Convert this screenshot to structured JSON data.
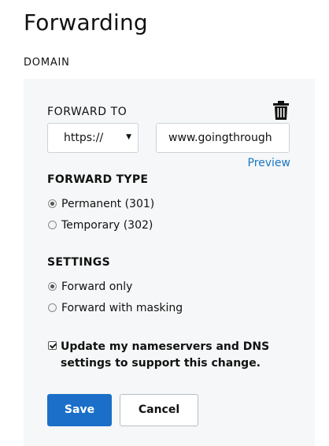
{
  "page": {
    "title": "Forwarding",
    "section_label": "DOMAIN"
  },
  "forward_to": {
    "label": "FORWARD TO",
    "delete_icon": "trash-icon",
    "protocol": {
      "selected": "https://",
      "icon": "caret-down-icon"
    },
    "url_value": "www.goingthrough",
    "preview_link": "Preview"
  },
  "forward_type": {
    "heading": "FORWARD TYPE",
    "options": [
      {
        "label": "Permanent (301)",
        "checked": true
      },
      {
        "label": "Temporary (302)",
        "checked": false
      }
    ]
  },
  "settings": {
    "heading": "SETTINGS",
    "options": [
      {
        "label": "Forward only",
        "checked": true
      },
      {
        "label": "Forward with masking",
        "checked": false
      }
    ]
  },
  "nameservers": {
    "checked": true,
    "label": "Update my nameservers and DNS settings to support this change."
  },
  "actions": {
    "save_label": "Save",
    "cancel_label": "Cancel",
    "primary_color": "#1b6fc8",
    "link_color": "#1976c5"
  }
}
